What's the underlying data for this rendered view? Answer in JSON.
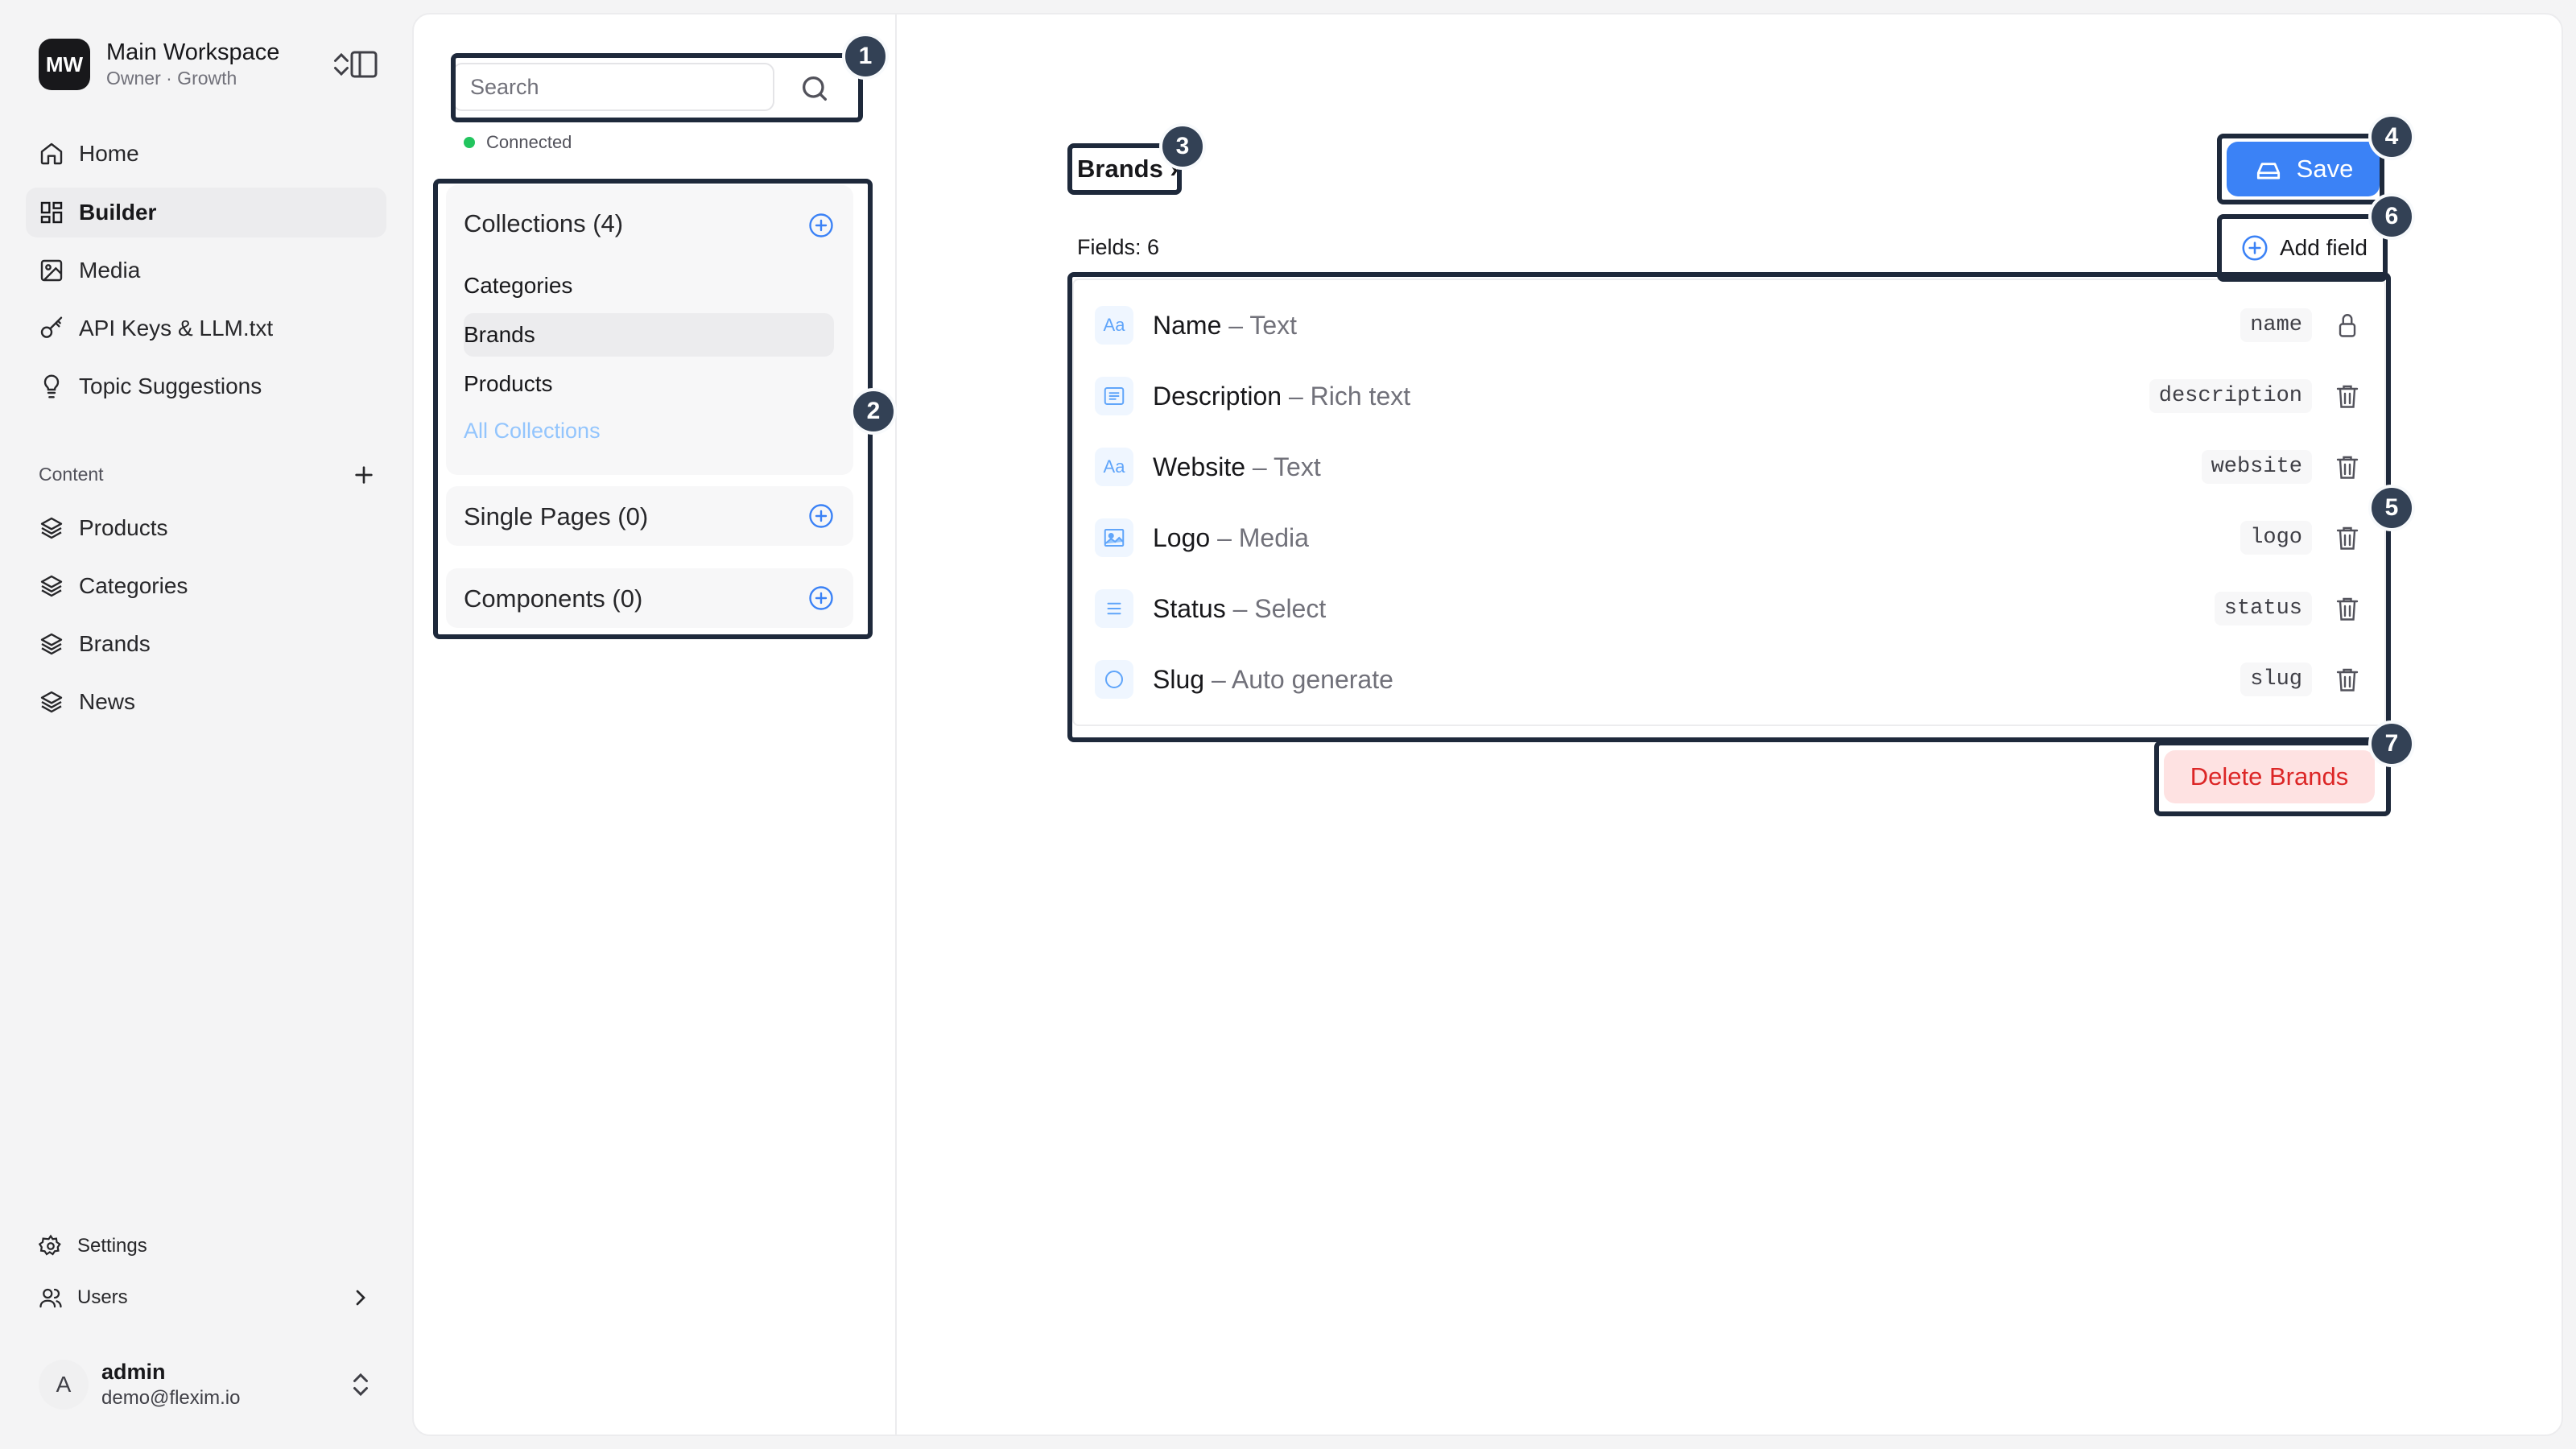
{
  "workspace": {
    "initials": "MW",
    "name": "Main Workspace",
    "subtitle": "Owner · Growth"
  },
  "nav": [
    {
      "label": "Home",
      "icon": "home-icon"
    },
    {
      "label": "Builder",
      "icon": "grid-icon",
      "active": true
    },
    {
      "label": "Media",
      "icon": "image-icon"
    },
    {
      "label": "API Keys & LLM.txt",
      "icon": "key-icon"
    },
    {
      "label": "Topic Suggestions",
      "icon": "lightbulb-icon"
    }
  ],
  "content_section": {
    "label": "Content",
    "items": [
      {
        "label": "Products",
        "icon": "layers-icon"
      },
      {
        "label": "Categories",
        "icon": "layers-icon"
      },
      {
        "label": "Brands",
        "icon": "layers-icon"
      },
      {
        "label": "News",
        "icon": "layers-icon"
      }
    ]
  },
  "footer": {
    "settings": "Settings",
    "users": "Users"
  },
  "user": {
    "initial": "A",
    "name": "admin",
    "email": "demo@flexim.io"
  },
  "builder": {
    "search_placeholder": "Search",
    "connection_status": "Connected",
    "collections": {
      "title": "Collections (4)",
      "items": [
        "Categories",
        "Brands",
        "Products"
      ],
      "active": "Brands",
      "all_link": "All Collections"
    },
    "single_pages": {
      "title": "Single Pages (0)"
    },
    "components": {
      "title": "Components (0)"
    }
  },
  "editor": {
    "breadcrumb": "Brands ›",
    "save_label": "Save",
    "fields_count": "Fields: 6",
    "add_field_label": "Add field",
    "fields": [
      {
        "name": "Name",
        "type": "– Text",
        "slug": "name",
        "icon": "text-icon",
        "action": "lock-icon"
      },
      {
        "name": "Description",
        "type": "– Rich text",
        "slug": "description",
        "icon": "rich-text-icon",
        "action": "trash-icon"
      },
      {
        "name": "Website",
        "type": "– Text",
        "slug": "website",
        "icon": "text-icon",
        "action": "trash-icon"
      },
      {
        "name": "Logo",
        "type": "– Media",
        "slug": "logo",
        "icon": "image-icon",
        "action": "trash-icon"
      },
      {
        "name": "Status",
        "type": "– Select",
        "slug": "status",
        "icon": "list-icon",
        "action": "trash-icon"
      },
      {
        "name": "Slug",
        "type": "– Auto generate",
        "slug": "slug",
        "icon": "circle-icon",
        "action": "trash-icon"
      }
    ],
    "delete_label": "Delete Brands"
  },
  "annotations": [
    "1",
    "2",
    "3",
    "4",
    "5",
    "6",
    "7"
  ],
  "colors": {
    "accent": "#3b82f6",
    "danger": "#dc2626",
    "danger_bg": "#fee2e2",
    "annotation": "#334155",
    "connected": "#22c55e"
  }
}
